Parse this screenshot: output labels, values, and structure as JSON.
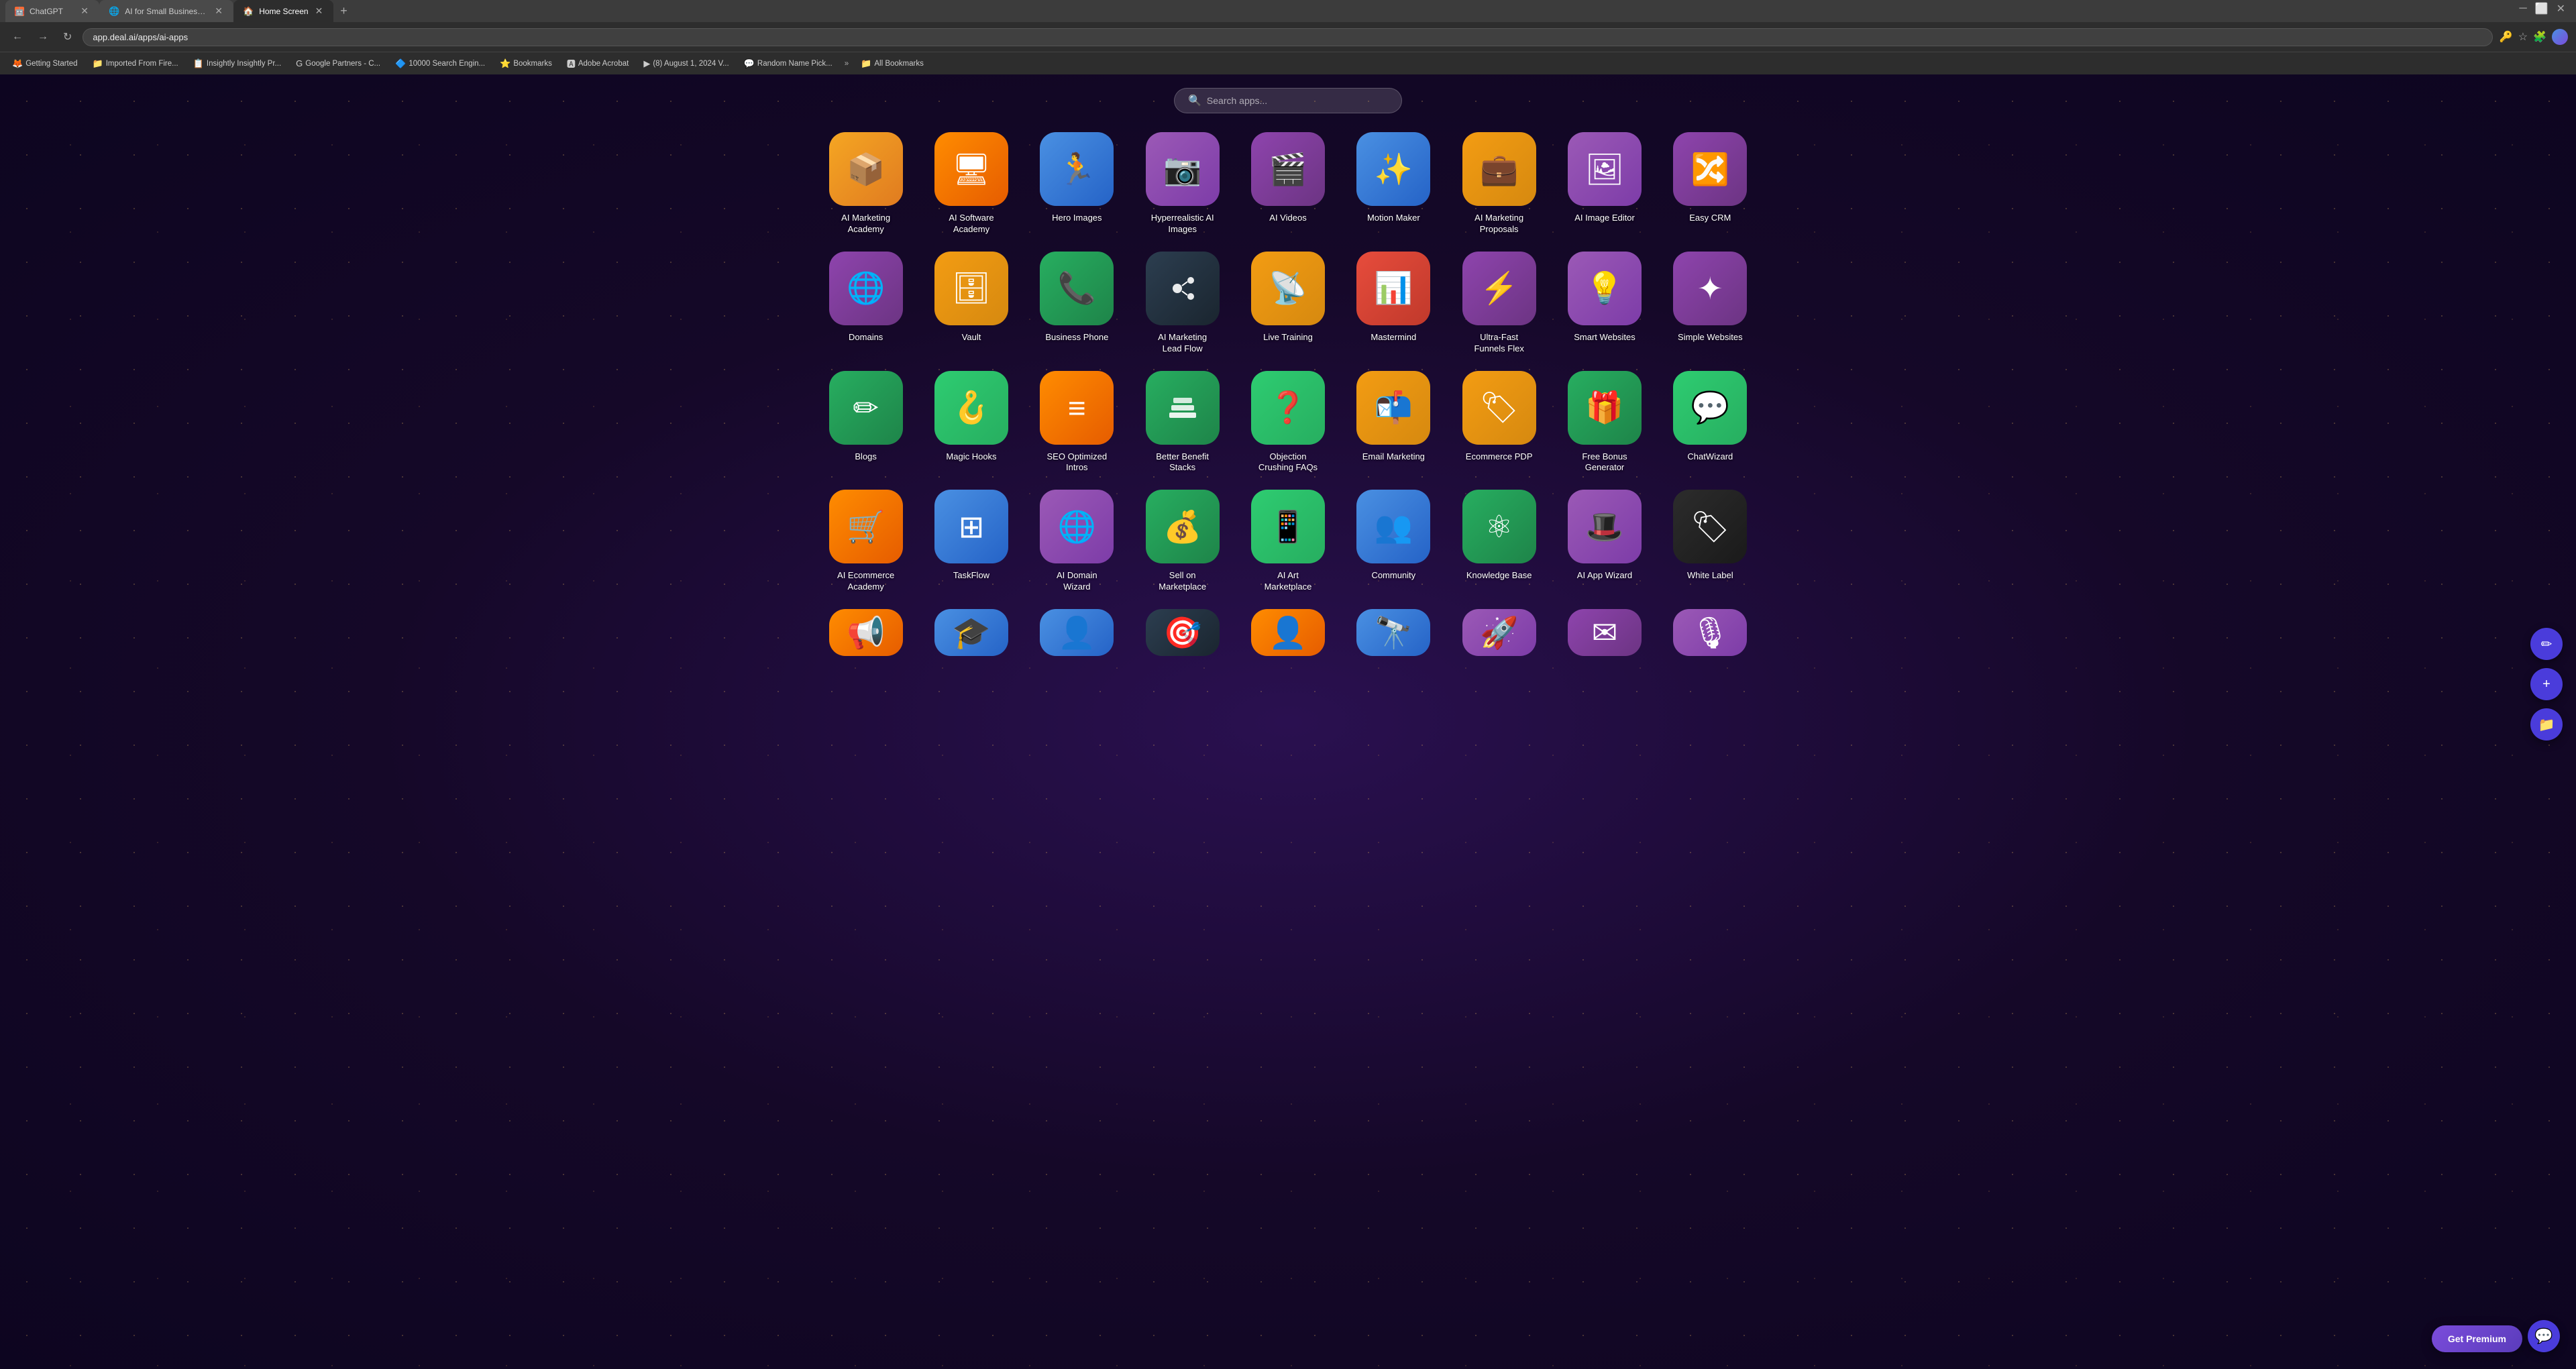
{
  "browser": {
    "tabs": [
      {
        "id": "tab-chatgpt",
        "label": "ChatGPT",
        "icon": "🤖",
        "active": false
      },
      {
        "id": "tab-ai-small-biz",
        "label": "AI for Small Business - Web Se...",
        "icon": "🌐",
        "active": false
      },
      {
        "id": "tab-home",
        "label": "Home Screen",
        "icon": "🏠",
        "active": true
      }
    ],
    "address": "app.deal.ai/apps/ai-apps",
    "bookmarks": [
      {
        "label": "Getting Started",
        "icon": "🦊"
      },
      {
        "label": "Imported From Fire...",
        "icon": "📁"
      },
      {
        "label": "Insightly Insightly Pr...",
        "icon": "📋"
      },
      {
        "label": "Google Partners - C...",
        "icon": "G"
      },
      {
        "label": "10000 Search Engin...",
        "icon": "🔷"
      },
      {
        "label": "Bookmarks",
        "icon": "⭐"
      },
      {
        "label": "Adobe Acrobat",
        "icon": "🅰"
      },
      {
        "label": "(8) August 1, 2024 V...",
        "icon": "▶"
      },
      {
        "label": "Random Name Pick...",
        "icon": "💬"
      },
      {
        "label": "All Bookmarks",
        "icon": "📁"
      }
    ]
  },
  "search": {
    "placeholder": "Search apps..."
  },
  "apps": {
    "row1": [
      {
        "id": "ai-marketing-academy",
        "label": "AI Marketing\nAcademy",
        "icon": "📦",
        "gradient": "grad-orange"
      },
      {
        "id": "ai-software-academy",
        "label": "AI Software\nAcademy",
        "icon": "🖥",
        "gradient": "grad-orange2"
      },
      {
        "id": "hero-images",
        "label": "Hero Images",
        "icon": "🏃",
        "gradient": "grad-blue"
      },
      {
        "id": "hyperrealistic-ai-images",
        "label": "Hyperrealistic AI\nImages",
        "icon": "📷",
        "gradient": "grad-purple"
      },
      {
        "id": "ai-videos",
        "label": "AI Videos",
        "icon": "🎬",
        "gradient": "grad-purple2"
      },
      {
        "id": "motion-maker",
        "label": "Motion Maker",
        "icon": "✨",
        "gradient": "grad-blue"
      },
      {
        "id": "ai-marketing-proposals",
        "label": "AI Marketing\nProposals",
        "icon": "💼",
        "gradient": "grad-gold"
      },
      {
        "id": "ai-image-editor",
        "label": "AI Image Editor",
        "icon": "🖼",
        "gradient": "grad-purple"
      },
      {
        "id": "easy-crm",
        "label": "Easy CRM",
        "icon": "🔀",
        "gradient": "grad-purple2"
      }
    ],
    "row2": [
      {
        "id": "domains",
        "label": "Domains",
        "icon": "🌐",
        "gradient": "grad-purple2"
      },
      {
        "id": "vault",
        "label": "Vault",
        "icon": "🗄",
        "gradient": "grad-gold"
      },
      {
        "id": "business-phone",
        "label": "Business Phone",
        "icon": "📞",
        "gradient": "grad-green"
      },
      {
        "id": "ai-marketing-lead-flow",
        "label": "AI Marketing\nLead Flow",
        "icon": "🔘",
        "gradient": "grad-dark"
      },
      {
        "id": "live-training",
        "label": "Live Training",
        "icon": "📡",
        "gradient": "grad-gold"
      },
      {
        "id": "mastermind",
        "label": "Mastermind",
        "icon": "📊",
        "gradient": "grad-red"
      },
      {
        "id": "ultra-fast-funnels-flex",
        "label": "Ultra-Fast\nFunnels Flex",
        "icon": "⚡",
        "gradient": "grad-purple2"
      },
      {
        "id": "smart-websites",
        "label": "Smart Websites",
        "icon": "💡",
        "gradient": "grad-purple"
      },
      {
        "id": "simple-websites",
        "label": "Simple Websites",
        "icon": "✦",
        "gradient": "grad-purple2"
      }
    ],
    "row3": [
      {
        "id": "blogs",
        "label": "Blogs",
        "icon": "✏",
        "gradient": "grad-green"
      },
      {
        "id": "magic-hooks",
        "label": "Magic Hooks",
        "icon": "🪝",
        "gradient": "grad-green2"
      },
      {
        "id": "seo-optimized-intros",
        "label": "SEO Optimized\nIntros",
        "icon": "≡",
        "gradient": "grad-orange2"
      },
      {
        "id": "better-benefit-stacks",
        "label": "Better Benefit\nStacks",
        "icon": "◼",
        "gradient": "grad-green"
      },
      {
        "id": "objection-crushing-faqs",
        "label": "Objection\nCrushing FAQs",
        "icon": "❓",
        "gradient": "grad-green2"
      },
      {
        "id": "email-marketing",
        "label": "Email Marketing",
        "icon": "📬",
        "gradient": "grad-gold"
      },
      {
        "id": "ecommerce-pdp",
        "label": "Ecommerce PDP",
        "icon": "🏷",
        "gradient": "grad-gold"
      },
      {
        "id": "free-bonus-generator",
        "label": "Free Bonus\nGenerator",
        "icon": "🎁",
        "gradient": "grad-green"
      },
      {
        "id": "chatwizard",
        "label": "ChatWizard",
        "icon": "💬",
        "gradient": "grad-green2"
      }
    ],
    "row4": [
      {
        "id": "ai-ecommerce-academy",
        "label": "AI Ecommerce\nAcademy",
        "icon": "🛒",
        "gradient": "grad-orange2"
      },
      {
        "id": "taskflow",
        "label": "TaskFlow",
        "icon": "⊞",
        "gradient": "grad-blue"
      },
      {
        "id": "ai-domain-wizard",
        "label": "AI Domain\nWizard",
        "icon": "🌐",
        "gradient": "grad-purple"
      },
      {
        "id": "sell-on-marketplace",
        "label": "Sell on\nMarketplace",
        "icon": "💰",
        "gradient": "grad-green"
      },
      {
        "id": "ai-art-marketplace",
        "label": "AI Art\nMarketplace",
        "icon": "📱",
        "gradient": "grad-green2"
      },
      {
        "id": "community",
        "label": "Community",
        "icon": "👥",
        "gradient": "grad-blue"
      },
      {
        "id": "knowledge-base",
        "label": "Knowledge Base",
        "icon": "⚛",
        "gradient": "grad-green"
      },
      {
        "id": "ai-app-wizard",
        "label": "AI App Wizard",
        "icon": "🎩",
        "gradient": "grad-purple"
      },
      {
        "id": "white-label",
        "label": "White Label",
        "icon": "🏷",
        "gradient": "grad-black"
      }
    ],
    "row5": [
      {
        "id": "app-r5-1",
        "label": "",
        "icon": "📢",
        "gradient": "grad-orange2"
      },
      {
        "id": "app-r5-2",
        "label": "",
        "icon": "🎓",
        "gradient": "grad-blue"
      },
      {
        "id": "app-r5-3",
        "label": "",
        "icon": "👤",
        "gradient": "grad-blue"
      },
      {
        "id": "app-r5-4",
        "label": "",
        "icon": "🎯",
        "gradient": "grad-dark"
      },
      {
        "id": "app-r5-5",
        "label": "",
        "icon": "👤",
        "gradient": "grad-orange2"
      },
      {
        "id": "app-r5-6",
        "label": "",
        "icon": "🔭",
        "gradient": "grad-blue"
      },
      {
        "id": "app-r5-7",
        "label": "",
        "icon": "🚀",
        "gradient": "grad-purple"
      },
      {
        "id": "app-r5-8",
        "label": "",
        "icon": "✉",
        "gradient": "grad-purple2"
      },
      {
        "id": "app-r5-9",
        "label": "",
        "icon": "🎙",
        "gradient": "grad-purple"
      }
    ]
  },
  "sidebar": {
    "buttons": [
      "✏",
      "+",
      "📁"
    ]
  },
  "footer": {
    "premium_label": "Get Premium"
  }
}
